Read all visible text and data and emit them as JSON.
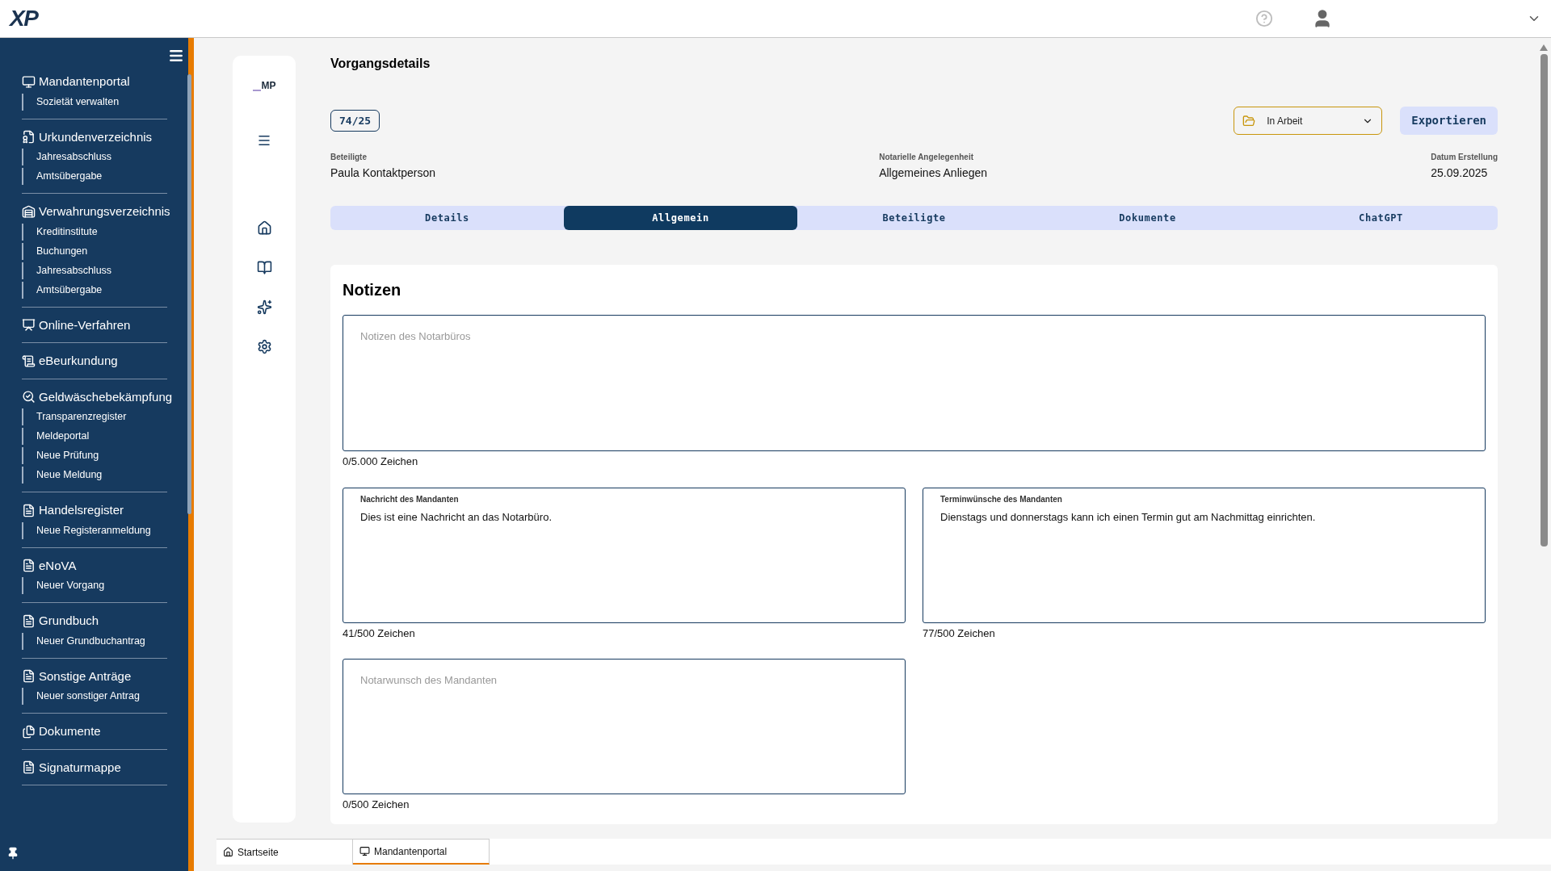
{
  "logo": {
    "text": "XP"
  },
  "sidebar": {
    "sections": [
      {
        "title": "Mandantenportal",
        "items": [
          "Sozietät verwalten"
        ]
      },
      {
        "title": "Urkundenverzeichnis",
        "items": [
          "Jahresabschluss",
          "Amtsübergabe"
        ]
      },
      {
        "title": "Verwahrungsverzeichnis",
        "items": [
          "Kreditinstitute",
          "Buchungen",
          "Jahresabschluss",
          "Amtsübergabe"
        ]
      },
      {
        "title": "Online-Verfahren"
      },
      {
        "title": "eBeurkundung"
      },
      {
        "title": "Geldwäschebekämpfung",
        "items": [
          "Transparenzregister",
          "Meldeportal",
          "Neue Prüfung",
          "Neue Meldung"
        ]
      },
      {
        "title": "Handelsregister",
        "items": [
          "Neue Registeranmeldung"
        ]
      },
      {
        "title": "eNoVA",
        "items": [
          "Neuer Vorgang"
        ]
      },
      {
        "title": "Grundbuch",
        "items": [
          "Neuer Grundbuchantrag"
        ]
      },
      {
        "title": "Sonstige Anträge",
        "items": [
          "Neuer sonstiger Antrag"
        ]
      },
      {
        "title": "Dokumente"
      },
      {
        "title": "Signaturmappe"
      }
    ]
  },
  "rail": {
    "brand": "MP"
  },
  "page": {
    "title": "Vorgangsdetails",
    "case_number": "74/25",
    "status": "In Arbeit",
    "export_button": "Exportieren",
    "fields": [
      {
        "label": "Beteiligte",
        "value": "Paula Kontaktperson"
      },
      {
        "label": "Notarielle Angelegenheit",
        "value": "Allgemeines Anliegen"
      },
      {
        "label": "Datum Erstellung",
        "value": "25.09.2025"
      }
    ],
    "tabs": [
      {
        "label": "Details",
        "selected": false
      },
      {
        "label": "Allgemein",
        "selected": true
      },
      {
        "label": "Beteiligte",
        "selected": false
      },
      {
        "label": "Dokumente",
        "selected": false
      },
      {
        "label": "ChatGPT",
        "selected": false
      }
    ]
  },
  "notes": {
    "title": "Notizen",
    "office_notes": {
      "placeholder": "Notizen des Notarbüros",
      "counter": "0/5.000 Zeichen"
    },
    "client_message": {
      "label": "Nachricht des Mandanten",
      "value": "Dies ist eine Nachricht an das Notarbüro.",
      "counter": "41/500 Zeichen"
    },
    "appointment_wishes": {
      "label": "Terminwünsche des Mandanten",
      "value": "Dienstags und donnerstags kann ich einen Termin gut am Nachmittag einrichten.",
      "counter": "77/500 Zeichen"
    },
    "notary_wish": {
      "placeholder": "Notarwunsch des Mandanten",
      "counter": "0/500 Zeichen"
    }
  },
  "bottom_tabs": [
    {
      "label": "Startseite",
      "selected": false
    },
    {
      "label": "Mandantenportal",
      "selected": true
    }
  ]
}
